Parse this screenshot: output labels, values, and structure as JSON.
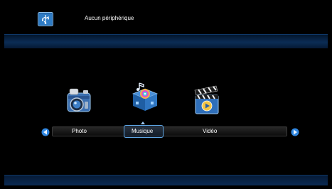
{
  "header": {
    "device_status": "Aucun périphérique",
    "device_icon": "usb-icon"
  },
  "menu": {
    "items": [
      {
        "label": "Photo",
        "icon": "camera-icon"
      },
      {
        "label": "Musique",
        "icon": "music-icon"
      },
      {
        "label": "Vidéo",
        "icon": "clapperboard-icon"
      }
    ],
    "selected": "Musique"
  },
  "colors": {
    "band": "#0b2c55",
    "highlight": "#5fa7e6",
    "arrow": "#3d8fe0"
  }
}
